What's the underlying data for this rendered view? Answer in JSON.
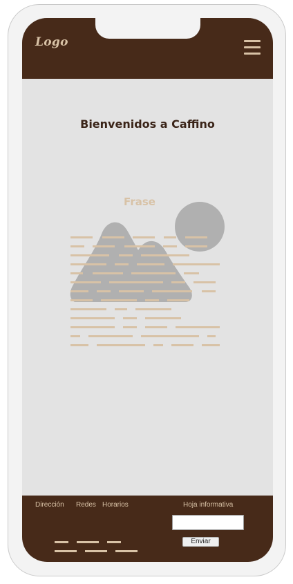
{
  "header": {
    "logo_text": "Logo",
    "menu_icon": "hamburger-menu-icon"
  },
  "main": {
    "welcome_title": "Bienvenidos a Caffino",
    "frase_label": "Frase",
    "image_icon": "image-placeholder-icon"
  },
  "footer": {
    "links": [
      "Dirección",
      "Redes",
      "Horarios"
    ],
    "newsletter_label": "Hoja informativa",
    "email_value": "",
    "send_label": "Enviar"
  },
  "colors": {
    "brown": "#472a19",
    "beige": "#d8c2a6",
    "background": "#e3e3e3",
    "placeholder_gray": "#b0b0b0"
  }
}
